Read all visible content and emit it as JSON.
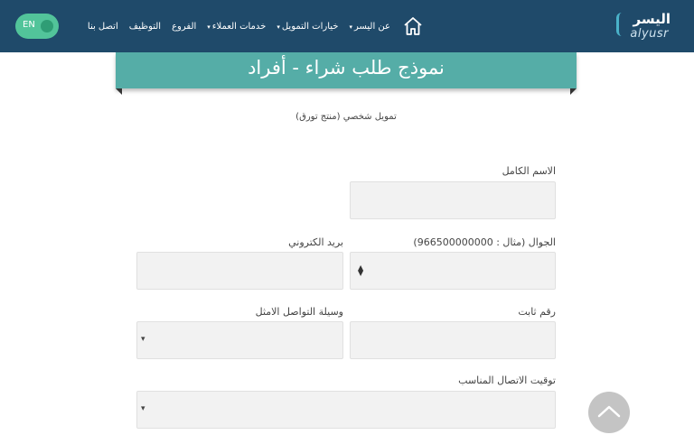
{
  "header": {
    "logo_ar": "اليسر",
    "logo_en": "alyusr",
    "nav": [
      {
        "label": "عن اليسر",
        "has_caret": true
      },
      {
        "label": "خيارات التمويل",
        "has_caret": true
      },
      {
        "label": "خدمات العملاء",
        "has_caret": true
      },
      {
        "label": "الفروع",
        "has_caret": false
      },
      {
        "label": "التوظيف",
        "has_caret": false
      },
      {
        "label": "اتصل بنا",
        "has_caret": false
      }
    ],
    "lang_label": "EN",
    "icons": {
      "home": "home-icon",
      "globe": "globe-icon"
    }
  },
  "banner": {
    "title": "نموذج طلب شراء - أفراد"
  },
  "subtitle": "تمويل شخصي (منتج تورق)",
  "form": {
    "full_name_label": "الاسم الكامل",
    "mobile_label": "الجوال (مثال : 966500000000)",
    "email_label": "بريد الكتروني",
    "landline_label": "رقم ثابت",
    "contact_method_label": "وسيلة التواصل الامثل",
    "contact_time_label": "توقيت الاتصال المناسب"
  },
  "colors": {
    "header_bg": "#1f4a6a",
    "banner_bg": "#55ada7",
    "lang_bg": "#52c49a"
  }
}
